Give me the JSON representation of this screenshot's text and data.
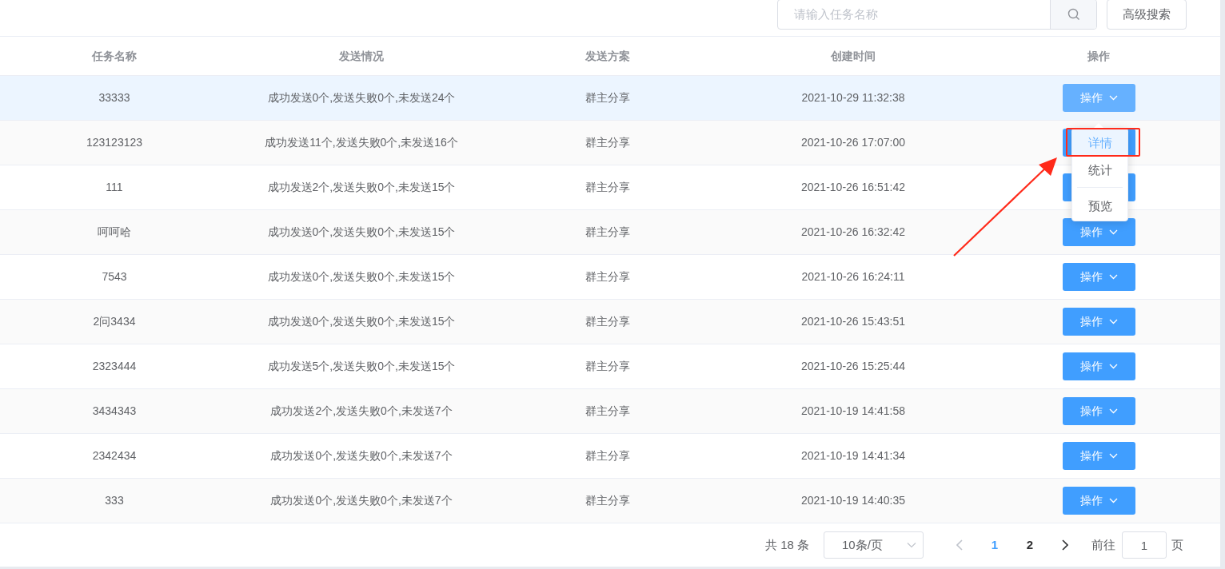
{
  "search": {
    "placeholder": "请输入任务名称",
    "advanced_button": "高级搜索"
  },
  "table": {
    "columns": [
      "任务名称",
      "发送情况",
      "发送方案",
      "创建时间",
      "操作"
    ],
    "rows": [
      {
        "name": "33333",
        "status": "成功发送0个,发送失败0个,未发送24个",
        "plan": "群主分享",
        "created": "2021-10-29 11:32:38",
        "action": "操作",
        "hovered": true
      },
      {
        "name": "123123123",
        "status": "成功发送11个,发送失败0个,未发送16个",
        "plan": "群主分享",
        "created": "2021-10-26 17:07:00",
        "hovered": false
      },
      {
        "name": "111",
        "status": "成功发送2个,发送失败0个,未发送15个",
        "plan": "群主分享",
        "created": "2021-10-26 16:51:42",
        "hovered": false
      },
      {
        "name": "呵呵哈",
        "status": "成功发送0个,发送失败0个,未发送15个",
        "plan": "群主分享",
        "created": "2021-10-26 16:32:42",
        "action": "操作",
        "hovered": false
      },
      {
        "name": "7543",
        "status": "成功发送0个,发送失败0个,未发送15个",
        "plan": "群主分享",
        "created": "2021-10-26 16:24:11",
        "action": "操作",
        "hovered": false
      },
      {
        "name": "2问3434",
        "status": "成功发送0个,发送失败0个,未发送15个",
        "plan": "群主分享",
        "created": "2021-10-26 15:43:51",
        "action": "操作",
        "hovered": false
      },
      {
        "name": "2323444",
        "status": "成功发送5个,发送失败0个,未发送15个",
        "plan": "群主分享",
        "created": "2021-10-26 15:25:44",
        "action": "操作",
        "hovered": false
      },
      {
        "name": "3434343",
        "status": "成功发送2个,发送失败0个,未发送7个",
        "plan": "群主分享",
        "created": "2021-10-19 14:41:58",
        "action": "操作",
        "hovered": false
      },
      {
        "name": "2342434",
        "status": "成功发送0个,发送失败0个,未发送7个",
        "plan": "群主分享",
        "created": "2021-10-19 14:41:34",
        "action": "操作",
        "hovered": false
      },
      {
        "name": "333",
        "status": "成功发送0个,发送失败0个,未发送7个",
        "plan": "群主分享",
        "created": "2021-10-19 14:40:35",
        "action": "操作",
        "hovered": false
      }
    ]
  },
  "dropdown_menu": {
    "items": [
      {
        "label": "详情",
        "selected": true,
        "divided": false
      },
      {
        "label": "统计",
        "selected": false,
        "divided": false
      },
      {
        "label": "预览",
        "selected": false,
        "divided": true
      }
    ]
  },
  "pagination": {
    "total": "共 18 条",
    "page_size": "10条/页",
    "prev_disabled": true,
    "pages": [
      {
        "label": "1",
        "selected": true
      },
      {
        "label": "2",
        "selected": false
      }
    ],
    "goto_label": "前往",
    "goto_value": "1",
    "goto_suffix": "页"
  }
}
